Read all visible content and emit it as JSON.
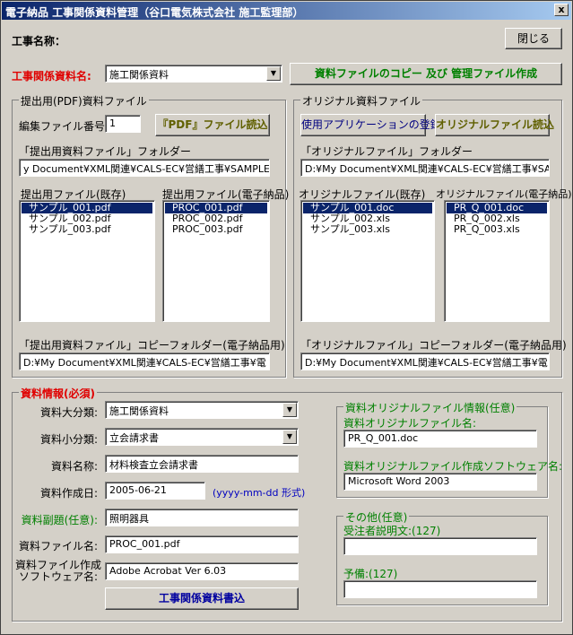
{
  "window": {
    "title": "電子納品 工事関係資料管理（谷口電気株式会社 施工監理部）",
    "close_glyph": "x"
  },
  "header": {
    "project_label": "工事名称：",
    "close_button": "閉じる",
    "doc_name_label": "工事関係資料名:",
    "doc_name_value": "施工関係資料",
    "copy_button": "資料ファイルのコピー 及び 管理ファイル作成"
  },
  "pdf_group": {
    "legend": "提出用(PDF)資料ファイル",
    "edit_no_label": "編集ファイル番号:",
    "edit_no_value": "1",
    "pdf_load_button": "『PDF』ファイル読込",
    "folder_label": "「提出用資料ファイル」フォルダー",
    "folder_value": "y Document¥XML関連¥CALS-EC¥営繕工事¥SAMPLE",
    "existing_label": "提出用ファイル(既存)",
    "existing_files": [
      "サンプル_001.pdf",
      "サンプル_002.pdf",
      "サンプル_003.pdf"
    ],
    "electronic_label": "提出用ファイル(電子納品)",
    "electronic_files": [
      "PROC_001.pdf",
      "PROC_002.pdf",
      "PROC_003.pdf"
    ],
    "copy_folder_label": "「提出用資料ファイル」コピーフォルダー(電子納品用)",
    "copy_folder_value": "D:¥My Document¥XML関連¥CALS-EC¥営繕工事¥電"
  },
  "orig_group": {
    "legend": "オリジナル資料ファイル",
    "app_register_button": "使用アプリケーションの登録",
    "orig_load_button": "オリジナルファイル読込",
    "folder_label": "「オリジナルファイル」フォルダー",
    "folder_value": "D:¥My Document¥XML関連¥CALS-EC¥営繕工事¥SA",
    "existing_label": "オリジナルファイル(既存)",
    "existing_files": [
      "サンプル_001.doc",
      "サンプル_002.xls",
      "サンプル_003.xls"
    ],
    "electronic_label": "オリジナルファイル(電子納品)",
    "electronic_files": [
      "PR_Q_001.doc",
      "PR_Q_002.xls",
      "PR_Q_003.xls"
    ],
    "copy_folder_label": "「オリジナルファイル」コピーフォルダー(電子納品用)",
    "copy_folder_value": "D:¥My Document¥XML関連¥CALS-EC¥営繕工事¥電"
  },
  "info_group": {
    "legend": "資料情報(必須)",
    "major_label": "資料大分類:",
    "major_value": "施工関係資料",
    "minor_label": "資料小分類:",
    "minor_value": "立会請求書",
    "name_label": "資料名称:",
    "name_value": "材料検査立会請求書",
    "date_label": "資料作成日:",
    "date_value": "2005-06-21",
    "date_hint": "(yyyy-mm-dd 形式)",
    "subtitle_label": "資料副題(任意):",
    "subtitle_value": "照明器具",
    "file_label": "資料ファイル名:",
    "file_value": "PROC_001.pdf",
    "software_label_1": "資料ファイル作成",
    "software_label_2": "ソフトウェア名:",
    "software_value": "Adobe Acrobat Ver 6.03",
    "write_button": "工事関係資料書込"
  },
  "orig_info_group": {
    "legend": "資料オリジナルファイル情報(任意)",
    "name_label": "資料オリジナルファイル名:",
    "name_value": "PR_Q_001.doc",
    "software_label": "資料オリジナルファイル作成ソフトウェア名:",
    "software_value": "Microsoft Word 2003"
  },
  "other_group": {
    "legend": "その他(任意)",
    "contractor_label": "受注者説明文:(127)",
    "contractor_value": "",
    "reserve_label": "予備:(127)",
    "reserve_value": ""
  },
  "icons": {
    "dropdown": "▼"
  }
}
